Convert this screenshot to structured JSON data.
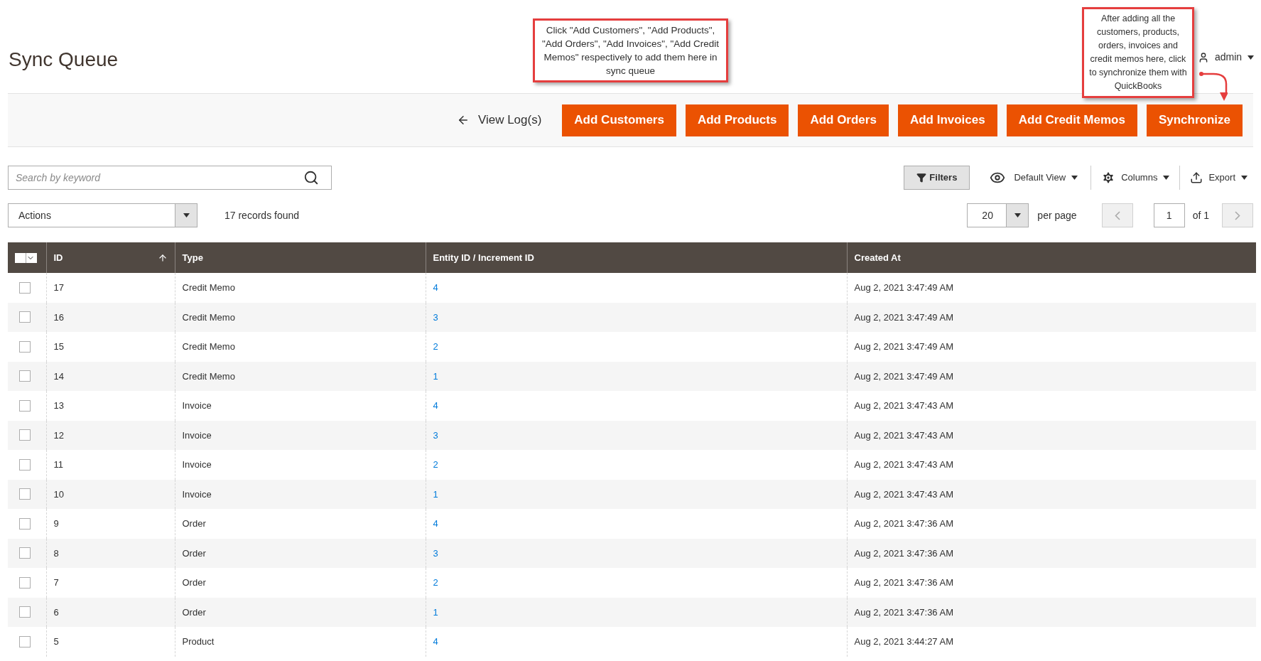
{
  "page_title": "Sync Queue",
  "user_menu": {
    "label": "admin"
  },
  "callouts": [
    {
      "text": "Click \"Add Customers\", \"Add Products\", \"Add Orders\", \"Add Invoices\", \"Add Credit Memos\" respectively to add them here in sync queue"
    },
    {
      "text": "After adding all the customers, products, orders, invoices and credit memos here, click to synchronize them with QuickBooks"
    }
  ],
  "toolbar": {
    "back_link": "View Log(s)",
    "buttons": [
      "Add Customers",
      "Add Products",
      "Add Orders",
      "Add Invoices",
      "Add Credit Memos",
      "Synchronize"
    ]
  },
  "search": {
    "placeholder": "Search by keyword"
  },
  "grid_controls": {
    "filters": "Filters",
    "view": "Default View",
    "columns": "Columns",
    "export": "Export"
  },
  "actions": {
    "label": "Actions"
  },
  "records_found": "17 records found",
  "pagination": {
    "per_page_value": "20",
    "per_page_label": "per page",
    "page": "1",
    "of": "of 1"
  },
  "table": {
    "columns": [
      "ID",
      "Type",
      "Entity ID / Increment ID",
      "Created At"
    ],
    "rows": [
      {
        "id": "17",
        "type": "Credit Memo",
        "entity": "4",
        "created": "Aug 2, 2021 3:47:49 AM",
        "checked": false
      },
      {
        "id": "16",
        "type": "Credit Memo",
        "entity": "3",
        "created": "Aug 2, 2021 3:47:49 AM",
        "checked": false
      },
      {
        "id": "15",
        "type": "Credit Memo",
        "entity": "2",
        "created": "Aug 2, 2021 3:47:49 AM",
        "checked": false
      },
      {
        "id": "14",
        "type": "Credit Memo",
        "entity": "1",
        "created": "Aug 2, 2021 3:47:49 AM",
        "checked": false
      },
      {
        "id": "13",
        "type": "Invoice",
        "entity": "4",
        "created": "Aug 2, 2021 3:47:43 AM",
        "checked": false
      },
      {
        "id": "12",
        "type": "Invoice",
        "entity": "3",
        "created": "Aug 2, 2021 3:47:43 AM",
        "checked": false
      },
      {
        "id": "11",
        "type": "Invoice",
        "entity": "2",
        "created": "Aug 2, 2021 3:47:43 AM",
        "checked": false
      },
      {
        "id": "10",
        "type": "Invoice",
        "entity": "1",
        "created": "Aug 2, 2021 3:47:43 AM",
        "checked": false
      },
      {
        "id": "9",
        "type": "Order",
        "entity": "4",
        "created": "Aug 2, 2021 3:47:36 AM",
        "checked": false
      },
      {
        "id": "8",
        "type": "Order",
        "entity": "3",
        "created": "Aug 2, 2021 3:47:36 AM",
        "checked": false
      },
      {
        "id": "7",
        "type": "Order",
        "entity": "2",
        "created": "Aug 2, 2021 3:47:36 AM",
        "checked": false
      },
      {
        "id": "6",
        "type": "Order",
        "entity": "1",
        "created": "Aug 2, 2021 3:47:36 AM",
        "checked": false
      },
      {
        "id": "5",
        "type": "Product",
        "entity": "4",
        "created": "Aug 2, 2021 3:44:27 AM",
        "checked": false
      }
    ]
  }
}
